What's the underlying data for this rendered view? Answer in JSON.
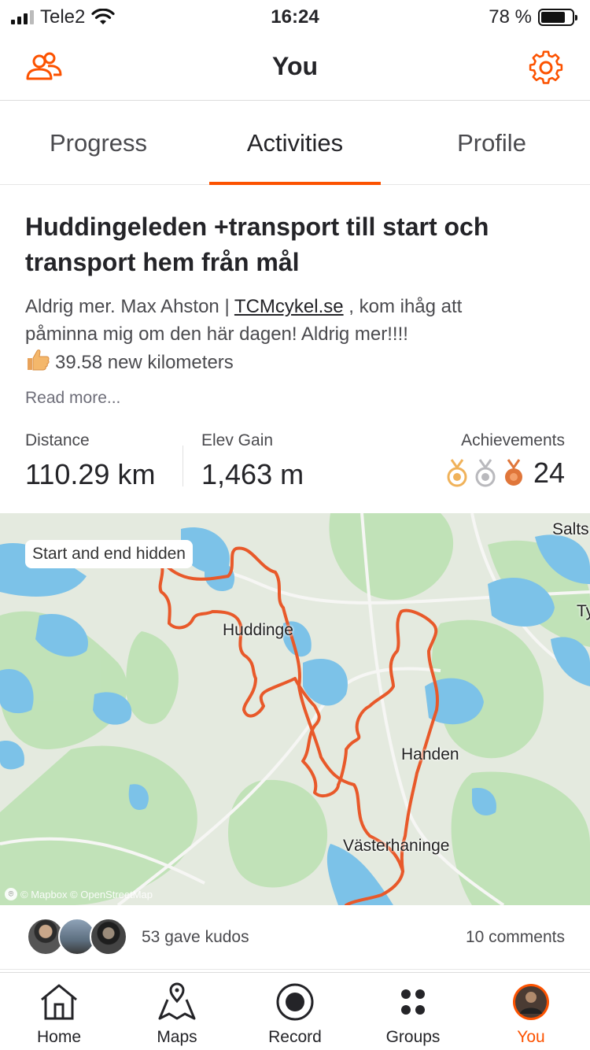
{
  "status_bar": {
    "carrier": "Tele2",
    "time": "16:24",
    "battery": "78 %",
    "battery_level": 0.78
  },
  "header": {
    "title": "You",
    "left_icon": "athletes-icon",
    "right_icon": "gear-icon"
  },
  "tabs": [
    {
      "label": "Progress",
      "active": false
    },
    {
      "label": "Activities",
      "active": true
    },
    {
      "label": "Profile",
      "active": false
    }
  ],
  "activity": {
    "title": "Huddingeleden +transport till start och transport hem från mål",
    "desc_line1_pre": "Aldrig mer. Max Ahston | ",
    "desc_link": "TCMcykel.se",
    "desc_line1_post": " , kom ihåg att",
    "desc_line2": "påminna mig om den här dagen! Aldrig mer!!!!",
    "desc_line3": "39.58 new kilometers",
    "read_more": "Read more...",
    "stats": {
      "distance_label": "Distance",
      "distance_value": "110.29 km",
      "elev_label": "Elev Gain",
      "elev_value": "1,463 m",
      "achievements_label": "Achievements",
      "achievements_value": "24"
    }
  },
  "map": {
    "badge": "Start and end hidden",
    "labels": [
      "Huddinge",
      "Handen",
      "Västerhaninge",
      "Salts",
      "Ty"
    ],
    "attribution": "© Mapbox © OpenStreetMap",
    "route_color": "#e8592a"
  },
  "kudos": {
    "kudos_text": "53 gave kudos",
    "comments_text": "10 comments"
  },
  "nav": [
    {
      "label": "Home",
      "icon": "home-icon",
      "active": false
    },
    {
      "label": "Maps",
      "icon": "map-icon",
      "active": false
    },
    {
      "label": "Record",
      "icon": "record-icon",
      "active": false
    },
    {
      "label": "Groups",
      "icon": "groups-icon",
      "active": false
    },
    {
      "label": "You",
      "icon": "avatar",
      "active": true
    }
  ],
  "colors": {
    "accent": "#fc5200",
    "text": "#242428",
    "muted": "#4a4a4e"
  }
}
